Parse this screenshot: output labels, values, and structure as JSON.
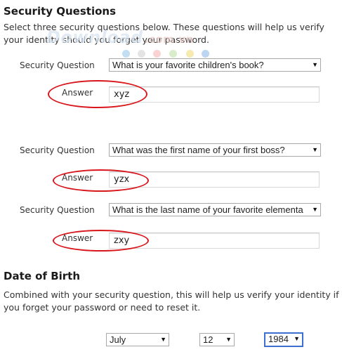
{
  "security": {
    "title": "Security Questions",
    "description": "Select three security questions below. These questions will help us verify your identity should you forget your password.",
    "question_label": "Security Question",
    "answer_label": "Answer",
    "questions": [
      {
        "question": "What is your favorite children's book?",
        "answer": "xyz"
      },
      {
        "question": "What was the first name of your first boss?",
        "answer": "yzx"
      },
      {
        "question": "What is the last name of your favorite elementa",
        "answer": "zxy"
      }
    ]
  },
  "dob": {
    "title": "Date of Birth",
    "description": "Combined with your security question, this will help us verify your identity if you forget your password or need to reset it.",
    "month": "July",
    "day": "12",
    "year": "1984"
  },
  "watermark": {
    "brand": "Download",
    "suffix": ".com.vn",
    "dot_colors": [
      "#a8d0ec",
      "#d9d9d9",
      "#f6c0bd",
      "#c9e6b4",
      "#f2e18b",
      "#9fc3ea",
      "#f4b1ae"
    ]
  },
  "highlight_color": "#d9161c"
}
